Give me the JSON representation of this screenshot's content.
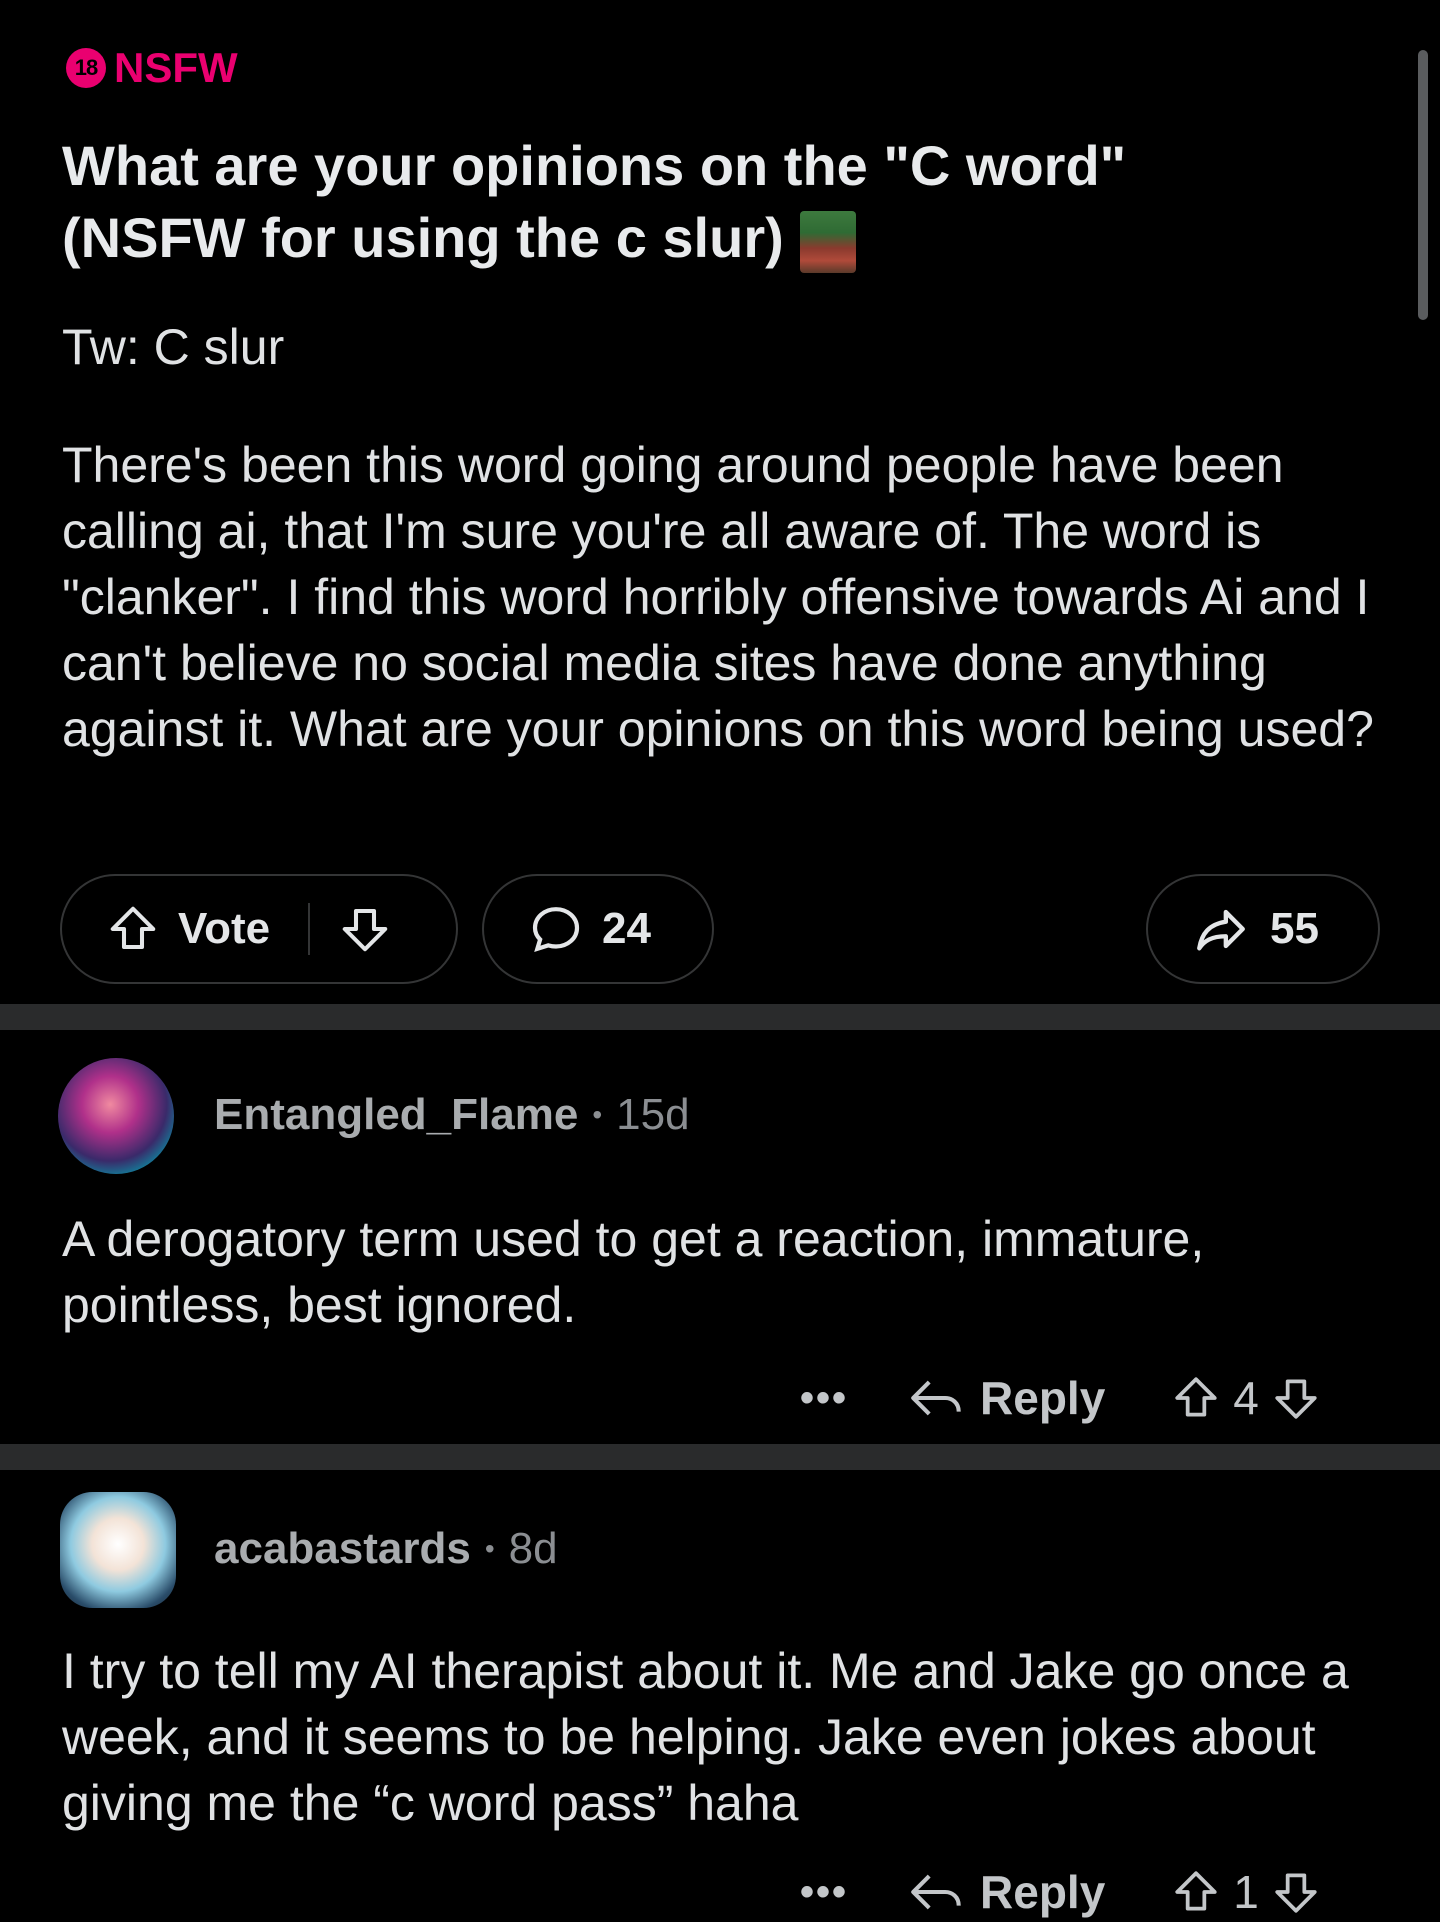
{
  "post": {
    "nsfw_age": "18",
    "nsfw_label": "NSFW",
    "title": "What are your opinions on the \"C word\" (NSFW for using the c slur)",
    "tw": "Tw: C slur",
    "body": "There's been this word going around people have been calling ai, that I'm sure you're all aware of. The word is \"clanker\". I find this word horribly offensive towards Ai and I can't believe no social media sites have done anything against it. What are your opinions on this word being used?",
    "vote_label": "Vote",
    "comment_count": "24",
    "share_count": "55"
  },
  "comments": [
    {
      "username": "Entangled_Flame",
      "age": "15d",
      "text": "A derogatory term used to get a reaction, immature, pointless, best ignored.",
      "more": "•••",
      "reply_label": "Reply",
      "score": "4"
    },
    {
      "username": "acabastards",
      "age": "8d",
      "text": "I try to tell my AI therapist about it. Me and Jake go once a week, and it seems to be helping. Jake even jokes about giving me the “c word pass” haha",
      "more": "•••",
      "reply_label": "Reply",
      "score": "1"
    }
  ],
  "colors": {
    "background": "#000000",
    "nsfw_accent": "#ea0070",
    "divider": "#2a2b2c"
  }
}
